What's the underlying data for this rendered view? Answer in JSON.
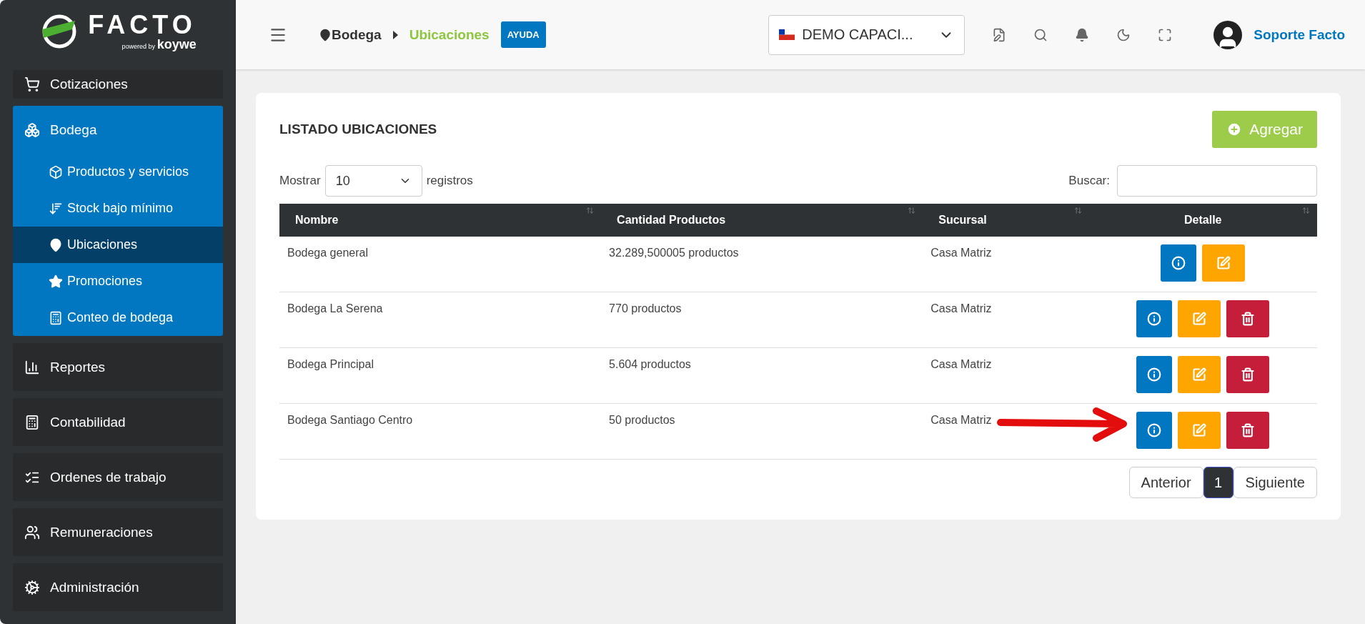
{
  "sidebar": {
    "logo": {
      "name": "FACTO",
      "tagline": "powered by",
      "brand": "koywe"
    },
    "items": [
      {
        "label": "Cotizaciones",
        "expanded": false
      },
      {
        "label": "Bodega",
        "expanded": true,
        "children": [
          {
            "label": "Productos y servicios",
            "selected": false
          },
          {
            "label": "Stock bajo mínimo",
            "selected": false
          },
          {
            "label": "Ubicaciones",
            "selected": true
          },
          {
            "label": "Promociones",
            "selected": false
          },
          {
            "label": "Conteo de bodega",
            "selected": false
          }
        ]
      },
      {
        "label": "Reportes",
        "expanded": false
      },
      {
        "label": "Contabilidad",
        "expanded": false
      },
      {
        "label": "Ordenes de trabajo",
        "expanded": false
      },
      {
        "label": "Remuneraciones",
        "expanded": false
      },
      {
        "label": "Administración",
        "expanded": false
      }
    ]
  },
  "header": {
    "breadcrumb": [
      "Bodega",
      "Ubicaciones"
    ],
    "help": "AYUDA",
    "company": "DEMO CAPACI...",
    "user": "Soporte Facto"
  },
  "card": {
    "title": "LISTADO UBICACIONES",
    "add_button": "Agregar",
    "length": {
      "before": "Mostrar",
      "value": "10",
      "after": "registros"
    },
    "search": {
      "label": "Buscar:"
    },
    "table": {
      "columns": [
        "Nombre",
        "Cantidad Productos",
        "Sucursal",
        "Detalle"
      ],
      "rows": [
        {
          "cells": [
            "Bodega general",
            "32.289,500005 productos",
            "Casa Matriz"
          ],
          "actions": [
            {
              "kind": "info"
            },
            {
              "kind": "edit"
            }
          ]
        },
        {
          "cells": [
            "Bodega La Serena",
            "770 productos",
            "Casa Matriz"
          ],
          "actions": [
            {
              "kind": "info"
            },
            {
              "kind": "edit"
            },
            {
              "kind": "delete"
            }
          ]
        },
        {
          "cells": [
            "Bodega Principal",
            "5.604 productos",
            "Casa Matriz"
          ],
          "actions": [
            {
              "kind": "info"
            },
            {
              "kind": "edit"
            },
            {
              "kind": "delete"
            }
          ]
        },
        {
          "cells": [
            "Bodega Santiago Centro",
            "50 productos",
            "Casa Matriz"
          ],
          "actions": [
            {
              "kind": "info"
            },
            {
              "kind": "edit"
            },
            {
              "kind": "delete"
            }
          ]
        }
      ]
    },
    "pagination": {
      "previous": "Anterior",
      "pages": [
        {
          "label": "1",
          "selected": true
        }
      ],
      "next": "Siguiente"
    }
  }
}
